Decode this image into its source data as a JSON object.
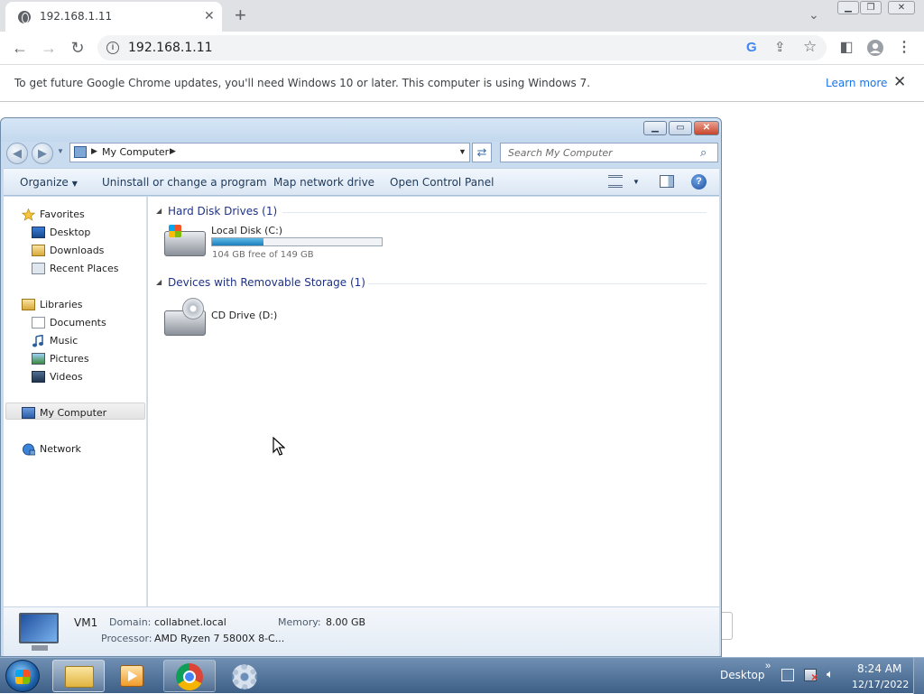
{
  "browser": {
    "tab_title": "192.168.1.11",
    "tab_close_glyph": "✕",
    "new_tab_glyph": "+",
    "tab_search_glyph": "⌄",
    "url": "192.168.1.11",
    "icons": [
      "back-icon",
      "forward-icon",
      "reload-icon",
      "site-info-icon",
      "google-lens-icon",
      "share-icon",
      "bookmark-star-icon",
      "side-panel-icon",
      "profile-icon",
      "menu-icon"
    ]
  },
  "infobar": {
    "message": "To get future Google Chrome updates, you'll need Windows 10 or later. This computer is using Windows 7.",
    "learn_more": "Learn more"
  },
  "explorer": {
    "breadcrumb": "My Computer",
    "search_placeholder": "Search My Computer",
    "commands": {
      "organize": "Organize",
      "uninstall": "Uninstall or change a program",
      "map_drive": "Map network drive",
      "control_panel": "Open Control Panel"
    },
    "nav": {
      "favorites": "Favorites",
      "desktop": "Desktop",
      "downloads": "Downloads",
      "recent": "Recent Places",
      "libraries": "Libraries",
      "documents": "Documents",
      "music": "Music",
      "pictures": "Pictures",
      "videos": "Videos",
      "my_computer": "My Computer",
      "network": "Network"
    },
    "groups": {
      "hdd_header": "Hard Disk Drives (1)",
      "removable_header": "Devices with Removable Storage (1)"
    },
    "drives": {
      "c_name": "Local Disk (C:)",
      "c_free": "104 GB free of 149 GB",
      "c_used_fraction": 0.302,
      "d_name": "CD Drive (D:)"
    },
    "details": {
      "computer_name": "VM1",
      "domain_label": "Domain:",
      "domain_value": "collabnet.local",
      "memory_label": "Memory:",
      "memory_value": "8.00 GB",
      "processor_label": "Processor:",
      "processor_value": "AMD Ryzen 7 5800X 8-C..."
    }
  },
  "taskbar": {
    "desktop_label": "Desktop",
    "time": "8:24 AM",
    "date": "12/17/2022"
  },
  "colors": {
    "accent": "#1a73e8",
    "group_header": "#1e3287",
    "progress_fill": "#1c7fbd"
  }
}
